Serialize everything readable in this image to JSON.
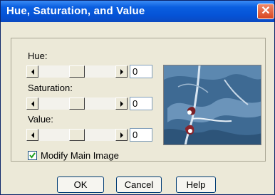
{
  "window": {
    "title": "Hue, Saturation, and Value"
  },
  "controls": {
    "hue": {
      "label": "Hue:",
      "value": "0"
    },
    "saturation": {
      "label": "Saturation:",
      "value": "0"
    },
    "value": {
      "label": "Value:",
      "value": "0"
    }
  },
  "checkbox": {
    "label": "Modify Main Image",
    "checked": true
  },
  "buttons": {
    "ok": "OK",
    "cancel": "Cancel",
    "help": "Help"
  },
  "icons": {
    "close": "close-icon",
    "left": "left-arrow-icon",
    "right": "right-arrow-icon",
    "check": "check-icon"
  }
}
